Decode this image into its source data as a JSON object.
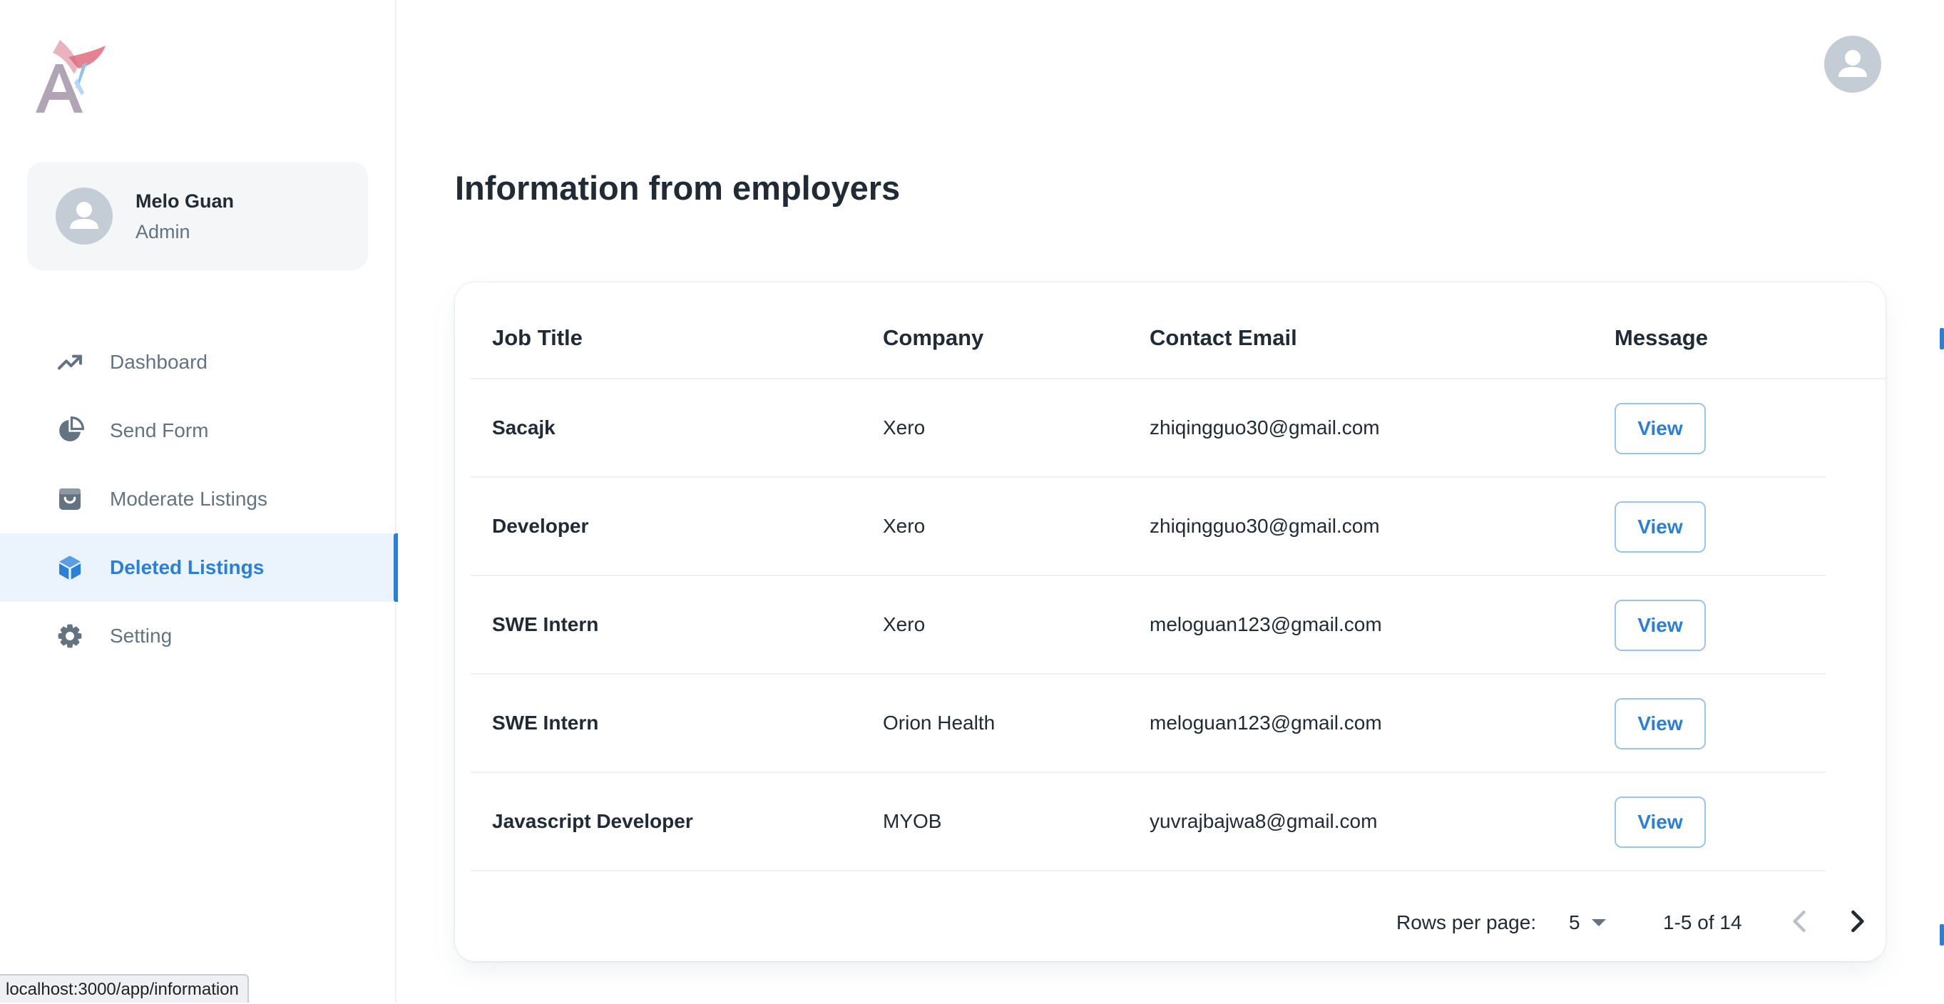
{
  "account": {
    "name": "Melo Guan",
    "role": "Admin"
  },
  "nav": [
    {
      "label": "Dashboard",
      "icon": "trending-up-icon",
      "active": false
    },
    {
      "label": "Send Form",
      "icon": "pie-chart-icon",
      "active": false
    },
    {
      "label": "Moderate Listings",
      "icon": "shopping-bag-icon",
      "active": false
    },
    {
      "label": "Deleted Listings",
      "icon": "cube-icon",
      "active": true
    },
    {
      "label": "Setting",
      "icon": "gear-icon",
      "active": false
    }
  ],
  "page": {
    "title": "Information from employers"
  },
  "table": {
    "headers": {
      "job_title": "Job Title",
      "company": "Company",
      "contact_email": "Contact Email",
      "message": "Message"
    },
    "rows": [
      {
        "job_title": "Sacajk",
        "company": "Xero",
        "email": "zhiqingguo30@gmail.com",
        "action": "View"
      },
      {
        "job_title": "Developer",
        "company": "Xero",
        "email": "zhiqingguo30@gmail.com",
        "action": "View"
      },
      {
        "job_title": "SWE Intern",
        "company": "Xero",
        "email": "meloguan123@gmail.com",
        "action": "View"
      },
      {
        "job_title": "SWE Intern",
        "company": "Orion Health",
        "email": "meloguan123@gmail.com",
        "action": "View"
      },
      {
        "job_title": "Javascript Developer",
        "company": "MYOB",
        "email": "yuvrajbajwa8@gmail.com",
        "action": "View"
      }
    ]
  },
  "pagination": {
    "rows_per_page_label": "Rows per page:",
    "rows_per_page": "5",
    "range": "1-5 of 14"
  },
  "status_bar": {
    "url": "localhost:3000/app/information"
  },
  "colors": {
    "accent": "#2a7fd9",
    "active_bg": "#ebf3fd",
    "text_primary": "#212b36",
    "text_secondary": "#637381",
    "avatar_gray": "#c4cdd5"
  }
}
